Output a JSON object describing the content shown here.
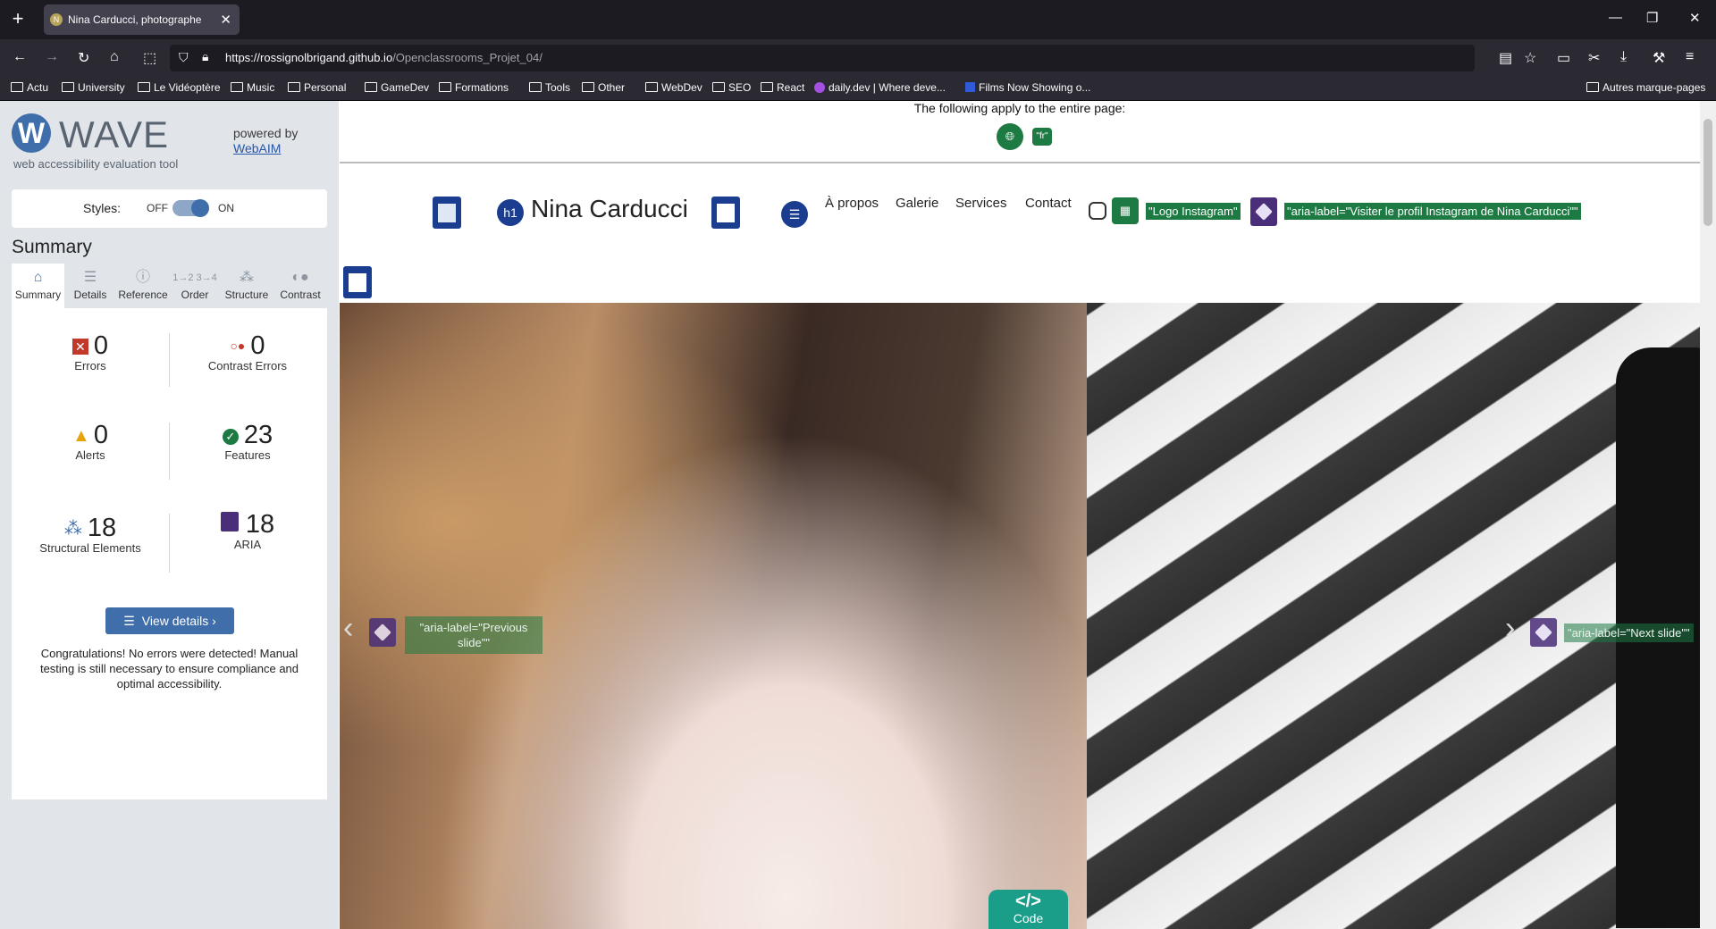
{
  "browser": {
    "tab_title": "Nina Carducci, photographe",
    "tab_favicon_letter": "N",
    "url_host": "https://rossignolbrigand.github.io",
    "url_path": "/Openclassrooms_Projet_04/"
  },
  "bookmarks": [
    "Actu",
    "University",
    "Le Vidéoptère",
    "Music",
    "Personal",
    "GameDev",
    "Formations",
    "Tools",
    "Other",
    "WebDev",
    "SEO",
    "React",
    "daily.dev | Where deve...",
    "Films Now Showing o...",
    "Autres marque-pages"
  ],
  "wave": {
    "logo_letter": "W",
    "name": "WAVE",
    "subtitle": "web accessibility evaluation tool",
    "powered_by": "powered by",
    "powered_link": "WebAIM",
    "styles_label": "Styles:",
    "styles_off": "OFF",
    "styles_on": "ON",
    "styles_enabled": true,
    "summary_title": "Summary",
    "tabs": [
      "Summary",
      "Details",
      "Reference",
      "Order",
      "Structure",
      "Contrast"
    ],
    "stats": {
      "errors": {
        "value": "0",
        "label": "Errors"
      },
      "contrast": {
        "value": "0",
        "label": "Contrast Errors"
      },
      "alerts": {
        "value": "0",
        "label": "Alerts"
      },
      "features": {
        "value": "23",
        "label": "Features"
      },
      "structural": {
        "value": "18",
        "label": "Structural Elements"
      },
      "aria": {
        "value": "18",
        "label": "ARIA"
      }
    },
    "view_details": "View details ›",
    "congrats": "Congratulations! No errors were detected! Manual testing is still necessary to ensure compliance and optimal accessibility."
  },
  "page": {
    "applies_note": "The following apply to the entire page:",
    "lang_badge": "\"fr\"",
    "h1_badge": "h1",
    "site_title": "Nina Carducci",
    "nav": [
      "À propos",
      "Galerie",
      "Services",
      "Contact"
    ],
    "logo_instagram_label": "\"Logo Instagram\"",
    "instagram_aria_label": "\"aria-label=\"Visiter le profil Instagram de Nina Carducci\"\"",
    "prev_slide_label": "\"aria-label=\"Previous slide\"\"",
    "next_slide_label": "\"aria-label=\"Next slide\"\"",
    "code_badge": "Code",
    "code_symbol": "</>"
  },
  "colors": {
    "wave_blue": "#3f6eaa",
    "feature_green": "#1e7a43",
    "aria_purple": "#4a2e7a",
    "error_red": "#c0392b",
    "alert_orange": "#e5a50a"
  }
}
